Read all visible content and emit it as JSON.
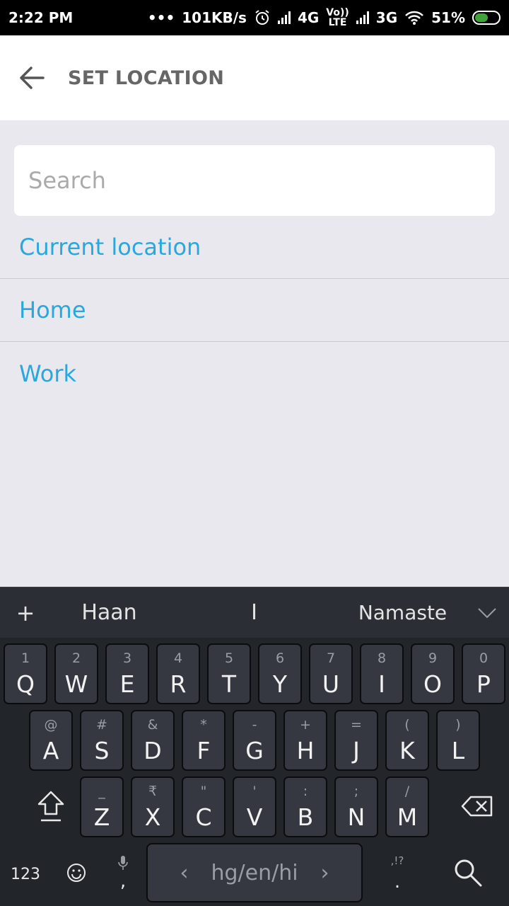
{
  "status": {
    "time": "2:22 PM",
    "dots": "•••",
    "speed": "101KB/s",
    "net1": "4G",
    "volte_top": "Vo))",
    "volte_bottom": "LTE",
    "net2": "3G",
    "battery": "51%"
  },
  "header": {
    "title": "SET LOCATION"
  },
  "search": {
    "placeholder": "Search",
    "value": ""
  },
  "list": [
    {
      "label": "Current location"
    },
    {
      "label": "Home"
    },
    {
      "label": "Work"
    }
  ],
  "keyboard": {
    "suggestions": {
      "plus": "+",
      "left": "Haan",
      "middle": "I",
      "right": "Namaste"
    },
    "row1": [
      {
        "main": "Q",
        "sub": "1"
      },
      {
        "main": "W",
        "sub": "2"
      },
      {
        "main": "E",
        "sub": "3"
      },
      {
        "main": "R",
        "sub": "4"
      },
      {
        "main": "T",
        "sub": "5"
      },
      {
        "main": "Y",
        "sub": "6"
      },
      {
        "main": "U",
        "sub": "7"
      },
      {
        "main": "I",
        "sub": "8"
      },
      {
        "main": "O",
        "sub": "9"
      },
      {
        "main": "P",
        "sub": "0"
      }
    ],
    "row2": [
      {
        "main": "A",
        "sub": "@"
      },
      {
        "main": "S",
        "sub": "#"
      },
      {
        "main": "D",
        "sub": "&"
      },
      {
        "main": "F",
        "sub": "*"
      },
      {
        "main": "G",
        "sub": "-"
      },
      {
        "main": "H",
        "sub": "+"
      },
      {
        "main": "J",
        "sub": "="
      },
      {
        "main": "K",
        "sub": "("
      },
      {
        "main": "L",
        "sub": ")"
      }
    ],
    "row3": [
      {
        "main": "Z",
        "sub": "_"
      },
      {
        "main": "X",
        "sub": "₹"
      },
      {
        "main": "C",
        "sub": "\""
      },
      {
        "main": "V",
        "sub": "'"
      },
      {
        "main": "B",
        "sub": ":"
      },
      {
        "main": "N",
        "sub": ";"
      },
      {
        "main": "M",
        "sub": "/"
      }
    ],
    "num_label": "123",
    "comma": ",",
    "space_label": "hg/en/hi",
    "period": ".",
    "punct_sub": ",!?"
  },
  "colors": {
    "accent": "#29a8dc",
    "background": "#e9e8ef",
    "keyboard": "#222529"
  }
}
